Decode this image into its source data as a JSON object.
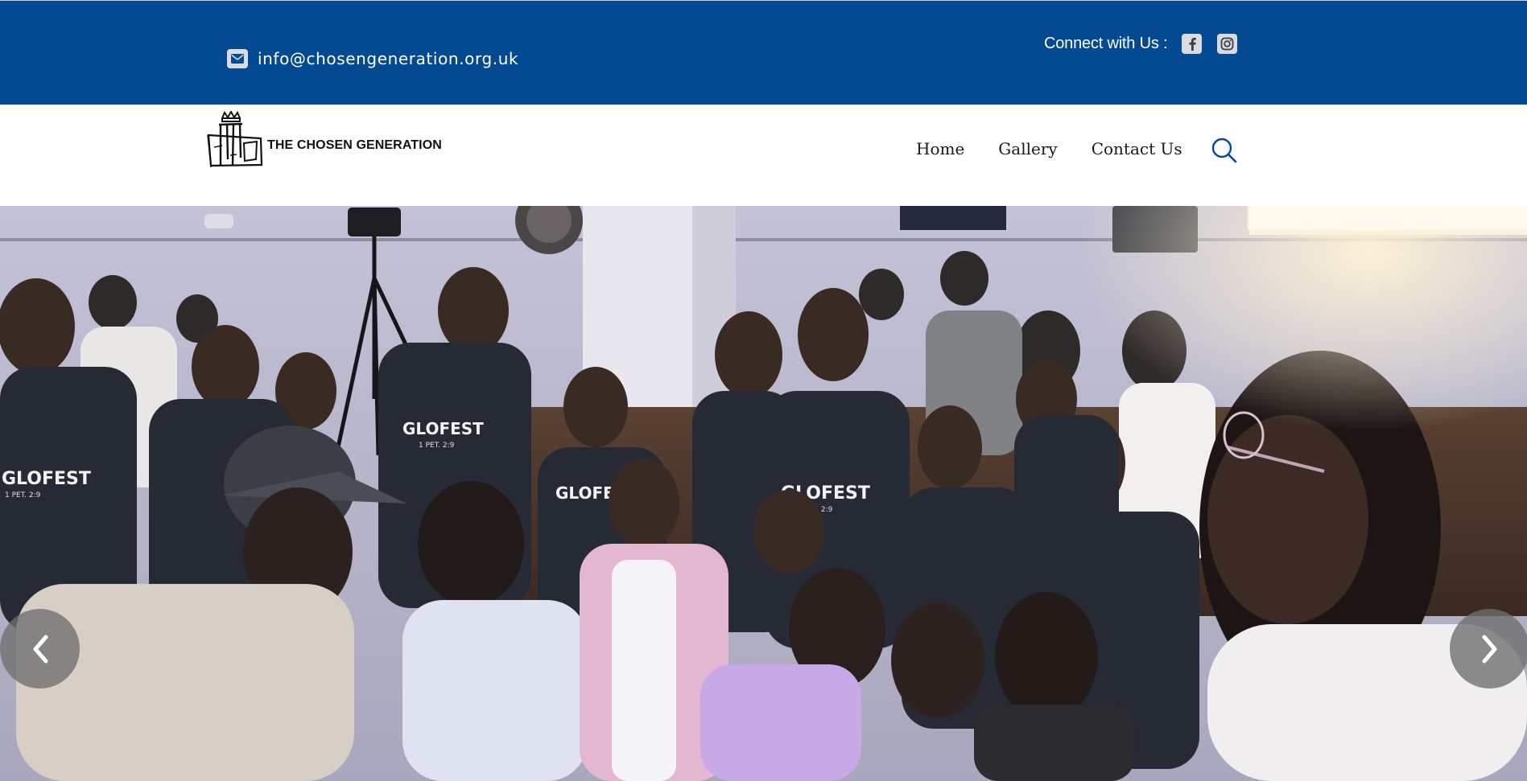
{
  "topbar": {
    "email": "info@chosengeneration.org.uk",
    "email_icon": "envelope-icon",
    "connect_label": "Connect with Us :",
    "social": [
      {
        "name": "facebook",
        "icon": "facebook-icon"
      },
      {
        "name": "instagram",
        "icon": "instagram-icon"
      }
    ]
  },
  "header": {
    "logo_text": "THE CHOSEN GENERATION",
    "nav": [
      {
        "label": "Home"
      },
      {
        "label": "Gallery"
      },
      {
        "label": "Contact Us"
      }
    ],
    "search_icon": "search-icon"
  },
  "hero": {
    "shirt_text": "GLOFEST",
    "shirt_subtext": "1 PET. 2:9",
    "prev_icon": "chevron-left-icon",
    "next_icon": "chevron-right-icon"
  },
  "colors": {
    "brand_blue": "#034a92",
    "icon_box": "#d9dde3",
    "arrow_bg": "#6e6e6e"
  }
}
